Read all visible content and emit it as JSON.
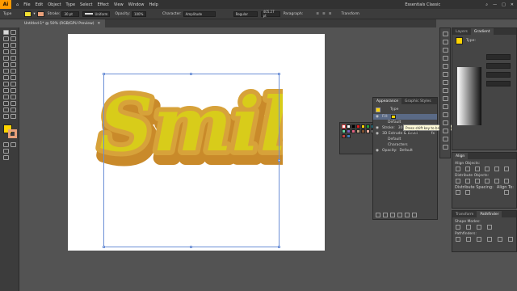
{
  "app": {
    "logo": "Ai",
    "workspace": "Essentials Classic"
  },
  "menu": [
    "File",
    "Edit",
    "Object",
    "Type",
    "Select",
    "Effect",
    "View",
    "Window",
    "Help"
  ],
  "control": {
    "type_label": "Type",
    "stroke_label": "Stroke:",
    "stroke_value": "30 pt",
    "profile": "Uniform",
    "opacity_label": "Opacity:",
    "opacity_value": "100%",
    "character_label": "Character:",
    "font": "Amplitude",
    "style": "Regular",
    "size": "405.27 pt",
    "paragraph_label": "Paragraph:",
    "transform_label": "Transform"
  },
  "document": {
    "tab": "Untitled-1* @ 50% (RGB/GPU Preview)"
  },
  "artwork": {
    "text": "Smile",
    "fill": "#d8cc1a",
    "stroke": "#c9952e"
  },
  "colors": {
    "fill": "#f2e033",
    "stroke": "#e8a07a",
    "accent": "#ffd400"
  },
  "appearance": {
    "tabs": [
      "Appearance",
      "Graphic Styles"
    ],
    "object_type": "Type",
    "stroke_label": "Stroke:",
    "fill_label": "Fill:",
    "opacity_default": "Default",
    "stroke_weight": "30 pt",
    "effect": "3D Extrude & Bevel",
    "characters": "Characters",
    "opacity_label": "Opacity:",
    "opacity_value": "Default",
    "tooltip": "Press shift key to bring up alternate color UI"
  },
  "layers_panel": {
    "tabs": [
      "Layers",
      "Gradient"
    ],
    "type_label": "Type:"
  },
  "align": {
    "title": "Align",
    "align_objects": "Align Objects:",
    "distribute_objects": "Distribute Objects:",
    "distribute_spacing": "Distribute Spacing:",
    "align_to": "Align To:"
  },
  "pathfinder": {
    "tabs": [
      "Transform",
      "Pathfinder"
    ],
    "shape_modes": "Shape Modes:",
    "pathfinders": "Pathfinders:"
  }
}
